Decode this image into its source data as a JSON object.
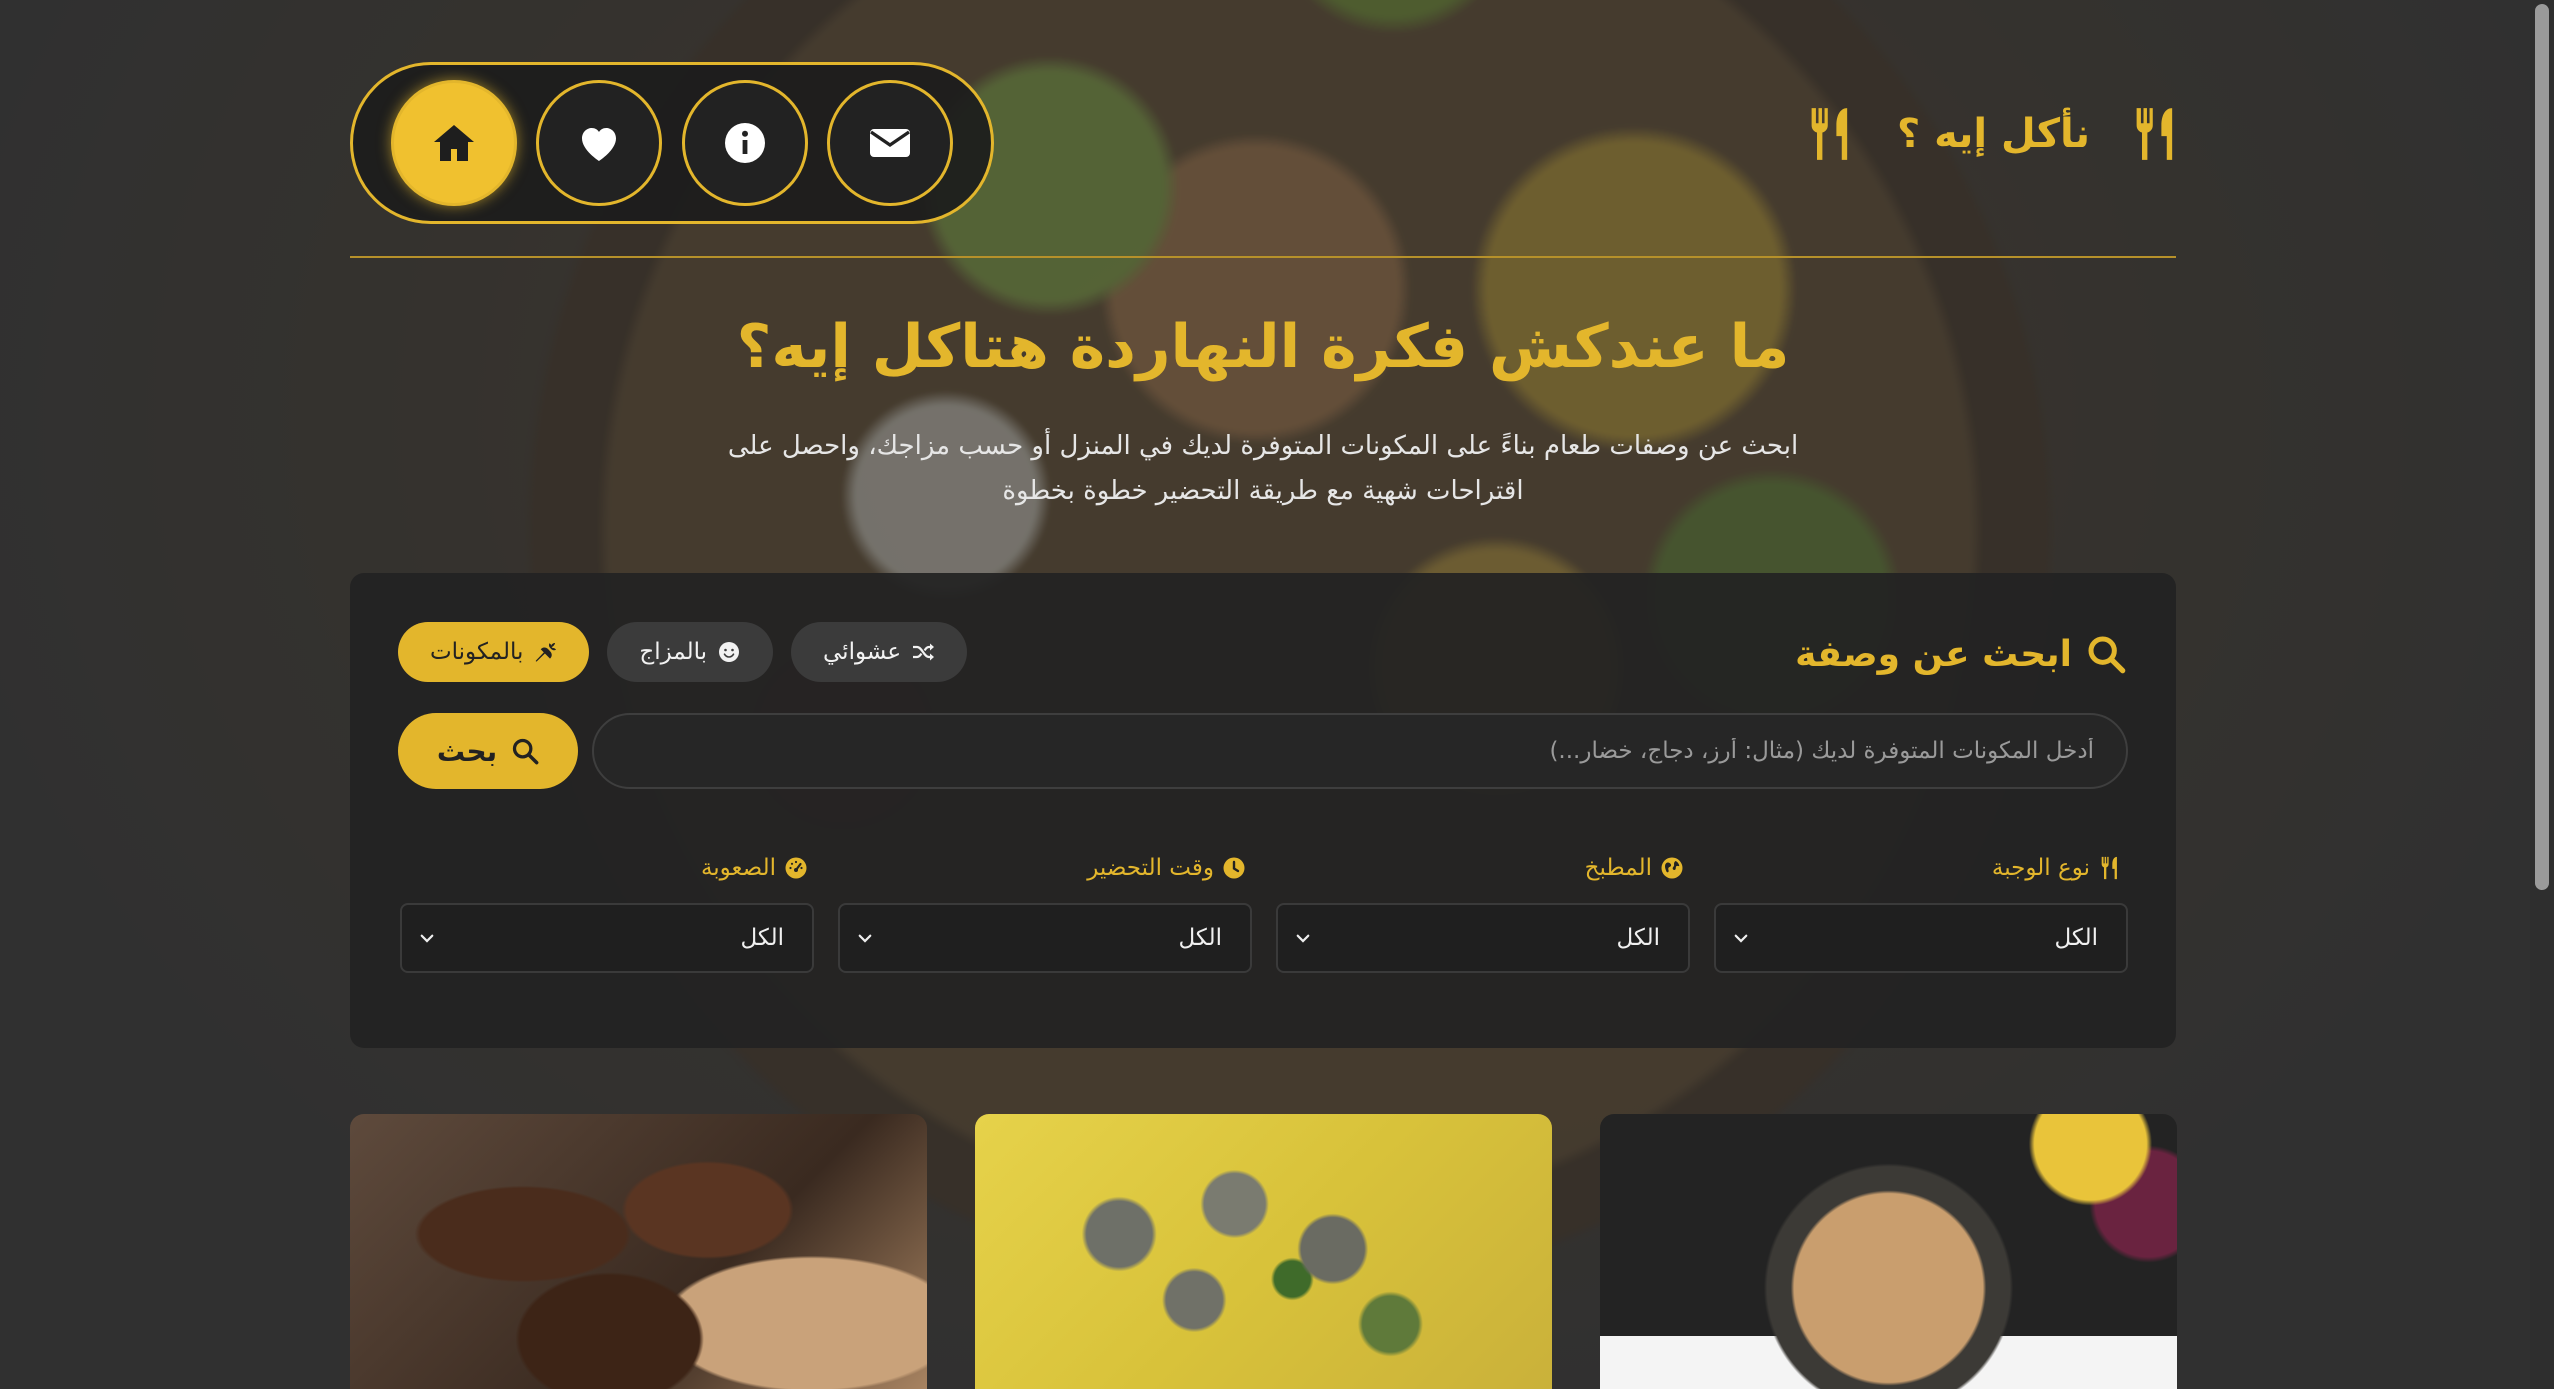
{
  "brand": {
    "title": "نأكل إيه ؟"
  },
  "nav": {
    "items": [
      {
        "icon": "home-icon",
        "active": true
      },
      {
        "icon": "heart-icon",
        "active": false
      },
      {
        "icon": "info-icon",
        "active": false
      },
      {
        "icon": "envelope-icon",
        "active": false
      }
    ]
  },
  "hero": {
    "title": "ما عندكش فكرة النهاردة هتاكل إيه؟",
    "subtitle": "ابحث عن وصفات طعام بناءً على المكونات المتوفرة لديك في المنزل أو حسب مزاجك، واحصل على اقتراحات شهية مع طريقة التحضير خطوة بخطوة"
  },
  "search": {
    "title": "ابحث عن وصفة",
    "modes": [
      {
        "label": "بالمكونات",
        "icon": "carrot-icon",
        "active": true
      },
      {
        "label": "بالمزاج",
        "icon": "smile-icon",
        "active": false
      },
      {
        "label": "عشوائي",
        "icon": "shuffle-icon",
        "active": false
      }
    ],
    "placeholder": "أدخل المكونات المتوفرة لديك (مثال: أرز، دجاج، خضار...)",
    "button_label": "بحث"
  },
  "filters": [
    {
      "label": "نوع الوجبة",
      "icon": "utensils-icon",
      "value": "الكل"
    },
    {
      "label": "المطبخ",
      "icon": "globe-icon",
      "value": "الكل"
    },
    {
      "label": "وقت التحضير",
      "icon": "clock-icon",
      "value": "الكل"
    },
    {
      "label": "الصعوبة",
      "icon": "gauge-icon",
      "value": "الكل"
    }
  ],
  "colors": {
    "accent": "#e3b62c",
    "panel": "#222222",
    "background": "#3c3c3c"
  }
}
